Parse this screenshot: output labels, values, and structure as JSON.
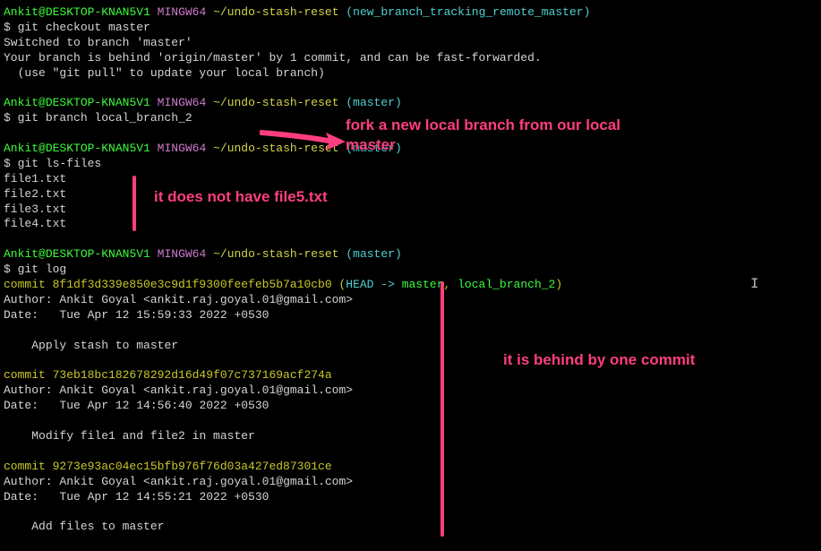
{
  "prompts": [
    {
      "user": "Ankit",
      "host": "DESKTOP-KNAN5V1",
      "env": "MINGW64",
      "path": "~/undo-stash-reset",
      "branch": "new_branch_tracking_remote_master",
      "command": "git checkout master",
      "output": [
        "Switched to branch 'master'",
        "Your branch is behind 'origin/master' by 1 commit, and can be fast-forwarded.",
        "  (use \"git pull\" to update your local branch)"
      ]
    },
    {
      "user": "Ankit",
      "host": "DESKTOP-KNAN5V1",
      "env": "MINGW64",
      "path": "~/undo-stash-reset",
      "branch": "master",
      "command": "git branch local_branch_2",
      "output": []
    },
    {
      "user": "Ankit",
      "host": "DESKTOP-KNAN5V1",
      "env": "MINGW64",
      "path": "~/undo-stash-reset",
      "branch": "master",
      "command": "git ls-files",
      "output": [
        "file1.txt",
        "file2.txt",
        "file3.txt",
        "file4.txt"
      ]
    },
    {
      "user": "Ankit",
      "host": "DESKTOP-KNAN5V1",
      "env": "MINGW64",
      "path": "~/undo-stash-reset",
      "branch": "master",
      "command": "git log",
      "output": []
    }
  ],
  "log": {
    "commits": [
      {
        "hash": "8f1df3d339e850e3c9d1f9300feefeb5b7a10cb0",
        "refs": {
          "head": "HEAD -> ",
          "branches": "master",
          "extra": ", local_branch_2"
        },
        "author": "Ankit Goyal <ankit.raj.goyal.01@gmail.com>",
        "date": "Tue Apr 12 15:59:33 2022 +0530",
        "message": "Apply stash to master"
      },
      {
        "hash": "73eb18bc182678292d16d49f07c737169acf274a",
        "author": "Ankit Goyal <ankit.raj.goyal.01@gmail.com>",
        "date": "Tue Apr 12 14:56:40 2022 +0530",
        "message": "Modify file1 and file2 in master"
      },
      {
        "hash": "9273e93ac04ec15bfb976f76d03a427ed87301ce",
        "author": "Ankit Goyal <ankit.raj.goyal.01@gmail.com>",
        "date": "Tue Apr 12 14:55:21 2022 +0530",
        "message": "Add files to master"
      }
    ]
  },
  "annotations": {
    "a1": "fork a new local branch from our local master",
    "a2": "it does not have file5.txt",
    "a3": "it is behind by one commit"
  },
  "labels": {
    "author": "Author: ",
    "date": "Date:   ",
    "commit": "commit "
  }
}
